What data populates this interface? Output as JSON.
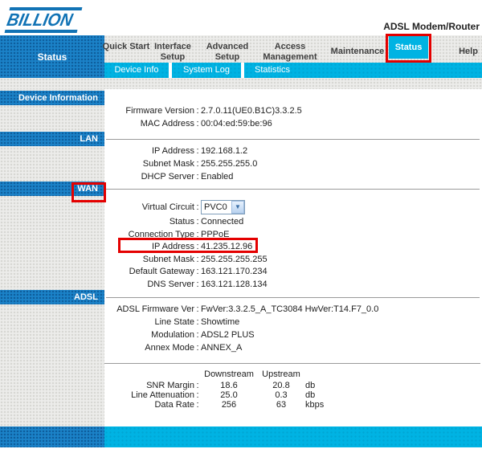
{
  "punctuation": {
    "colon": ":"
  },
  "header": {
    "logo": "BILLION",
    "product_name": "ADSL Modem/Router"
  },
  "nav": {
    "active_section": "Status",
    "items": [
      {
        "label": "Quick Start"
      },
      {
        "label": "Interface Setup"
      },
      {
        "label": "Advanced Setup"
      },
      {
        "label": "Access Management"
      },
      {
        "label": "Maintenance"
      },
      {
        "label": "Status"
      },
      {
        "label": "Help"
      }
    ],
    "subnav": [
      {
        "label": "Device Info"
      },
      {
        "label": "System Log"
      },
      {
        "label": "Statistics"
      }
    ]
  },
  "sidebar": {
    "sections": [
      {
        "label": "Device Information"
      },
      {
        "label": "LAN"
      },
      {
        "label": "WAN"
      },
      {
        "label": "ADSL"
      }
    ]
  },
  "device_information": {
    "rows": [
      {
        "label": "Firmware Version",
        "value": "2.7.0.11(UE0.B1C)3.3.2.5"
      },
      {
        "label": "MAC Address",
        "value": "00:04:ed:59:be:96"
      }
    ]
  },
  "lan": {
    "rows": [
      {
        "label": "IP Address",
        "value": "192.168.1.2"
      },
      {
        "label": "Subnet Mask",
        "value": "255.255.255.0"
      },
      {
        "label": "DHCP Server",
        "value": "Enabled"
      }
    ]
  },
  "wan": {
    "virtual_circuit": {
      "label": "Virtual Circuit",
      "selected": "PVC0"
    },
    "rows": [
      {
        "label": "Status",
        "value": "Connected"
      },
      {
        "label": "Connection Type",
        "value": "PPPoE"
      },
      {
        "label": "IP Address",
        "value": "41.235.12.96"
      },
      {
        "label": "Subnet Mask",
        "value": "255.255.255.255"
      },
      {
        "label": "Default Gateway",
        "value": "163.121.170.234"
      },
      {
        "label": "DNS Server",
        "value": "163.121.128.134"
      }
    ]
  },
  "adsl": {
    "rows": [
      {
        "label": "ADSL Firmware Ver",
        "value": "FwVer:3.3.2.5_A_TC3084 HwVer:T14.F7_0.0"
      },
      {
        "label": "Line State",
        "value": "Showtime"
      },
      {
        "label": "Modulation",
        "value": "ADSL2 PLUS"
      },
      {
        "label": "Annex Mode",
        "value": "ANNEX_A"
      }
    ],
    "stats": {
      "columns": [
        "Downstream",
        "Upstream"
      ],
      "rows": [
        {
          "label": "SNR Margin",
          "downstream": "18.6",
          "upstream": "20.8",
          "unit": "db"
        },
        {
          "label": "Line Attenuation",
          "downstream": "25.0",
          "upstream": "0.3",
          "unit": "db"
        },
        {
          "label": "Data Rate",
          "downstream": "256",
          "upstream": "63",
          "unit": "kbps"
        }
      ]
    }
  },
  "icons": {
    "chevron_down": "▼"
  },
  "colors": {
    "section_blue": "#1b82c8",
    "subnav_cyan": "#00b3e3",
    "annotation_red": "#e40000",
    "logo_blue": "#1173b5"
  }
}
